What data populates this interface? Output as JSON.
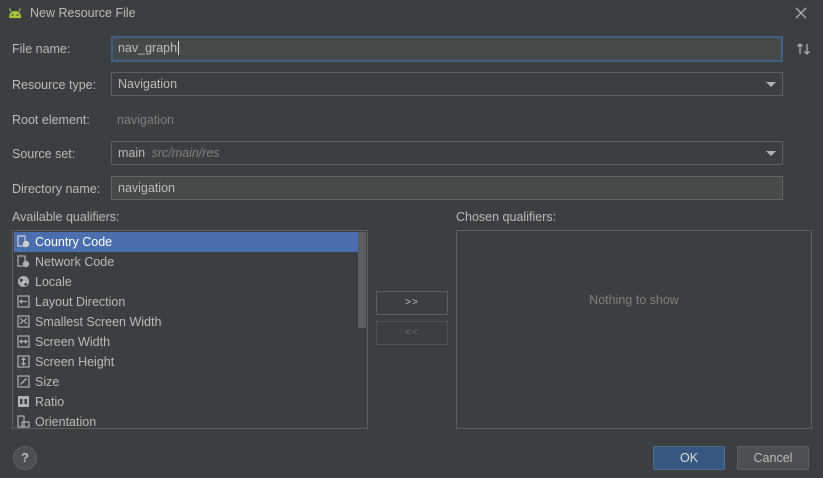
{
  "window": {
    "title": "New Resource File",
    "app_icon": "android-icon",
    "close_icon": "close-icon"
  },
  "form": {
    "file_name_label": "File name:",
    "file_name_value": "nav_graph",
    "resource_type_label": "Resource type:",
    "resource_type_value": "Navigation",
    "root_element_label": "Root element:",
    "root_element_value": "navigation",
    "source_set_label": "Source set:",
    "source_set_value": "main",
    "source_set_path": "src/main/res",
    "directory_label": "Directory name:",
    "directory_value": "navigation",
    "sort_icon": "sort-icon"
  },
  "qualifiers": {
    "available_label": "Available qualifiers:",
    "chosen_label": "Chosen qualifiers:",
    "empty_text": "Nothing to show",
    "add_label": ">>",
    "remove_label": "<<",
    "items": [
      {
        "label": "Country Code",
        "icon": "country-code-icon",
        "selected": true
      },
      {
        "label": "Network Code",
        "icon": "network-code-icon",
        "selected": false
      },
      {
        "label": "Locale",
        "icon": "globe-icon",
        "selected": false
      },
      {
        "label": "Layout Direction",
        "icon": "layout-direction-icon",
        "selected": false
      },
      {
        "label": "Smallest Screen Width",
        "icon": "smallest-width-icon",
        "selected": false
      },
      {
        "label": "Screen Width",
        "icon": "screen-width-icon",
        "selected": false
      },
      {
        "label": "Screen Height",
        "icon": "screen-height-icon",
        "selected": false
      },
      {
        "label": "Size",
        "icon": "size-icon",
        "selected": false
      },
      {
        "label": "Ratio",
        "icon": "ratio-icon",
        "selected": false
      },
      {
        "label": "Orientation",
        "icon": "orientation-icon",
        "selected": false
      }
    ]
  },
  "footer": {
    "help_label": "?",
    "ok_label": "OK",
    "cancel_label": "Cancel"
  },
  "colors": {
    "background": "#3c3f41",
    "selection": "#4b6eaf",
    "focus_border": "#3d6185",
    "ok_button": "#365880",
    "android_green": "#a4c639"
  }
}
